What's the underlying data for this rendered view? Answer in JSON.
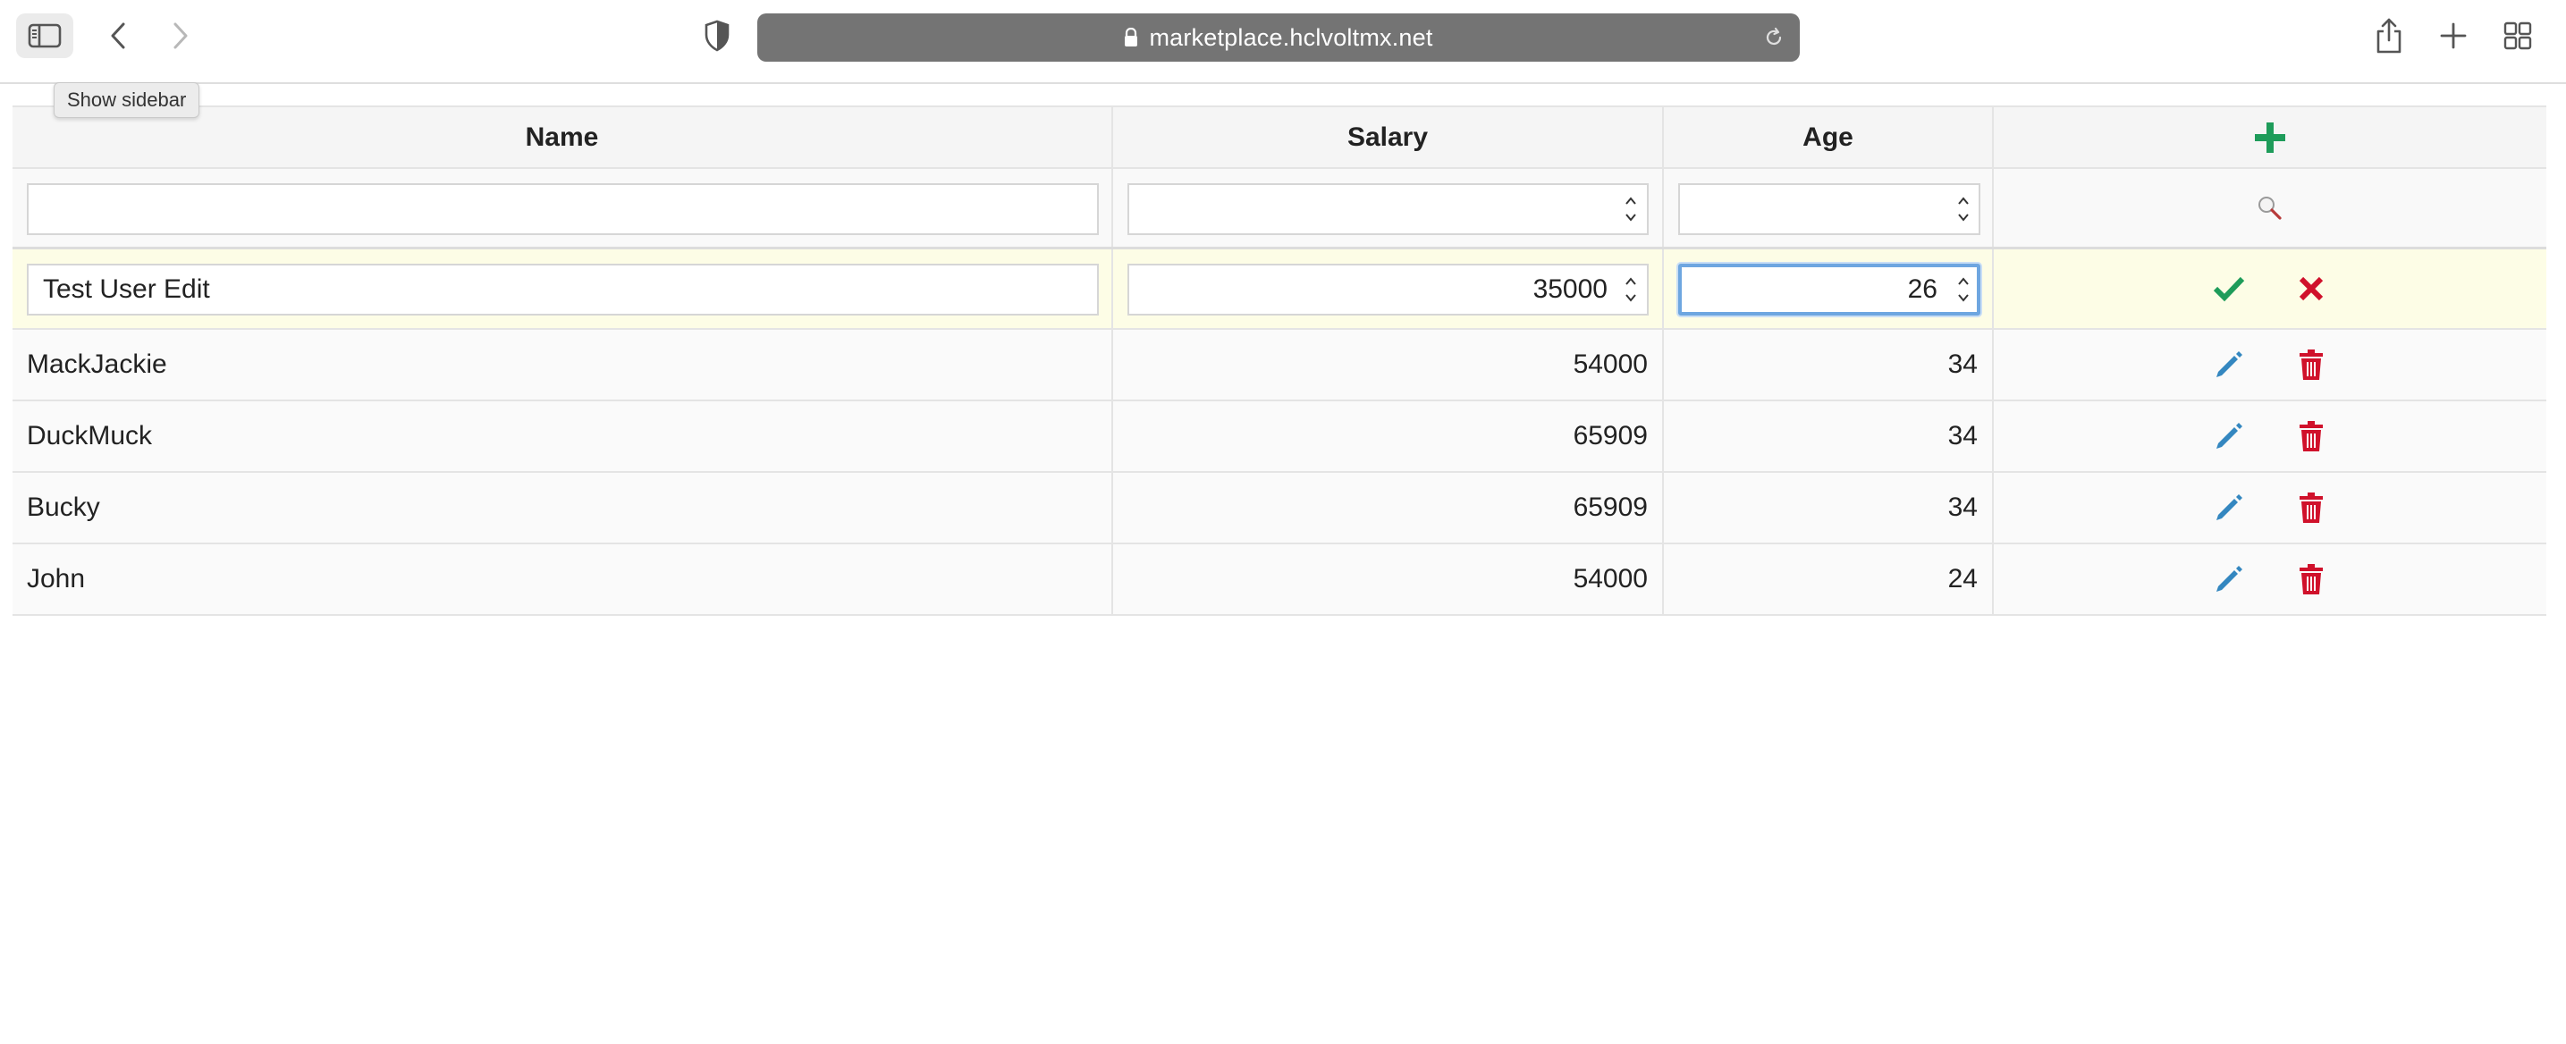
{
  "browser": {
    "url": "marketplace.hclvoltmx.net",
    "tooltip": "Show sidebar"
  },
  "grid": {
    "columns": [
      "Name",
      "Salary",
      "Age"
    ],
    "filter": {
      "name": "",
      "salary": "",
      "age": ""
    },
    "edit_row": {
      "name": "Test User Edit",
      "salary": "35000",
      "age": "26"
    },
    "rows": [
      {
        "name": "MackJackie",
        "salary": "54000",
        "age": "34"
      },
      {
        "name": "DuckMuck",
        "salary": "65909",
        "age": "34"
      },
      {
        "name": "Bucky",
        "salary": "65909",
        "age": "34"
      },
      {
        "name": "John",
        "salary": "54000",
        "age": "24"
      }
    ]
  },
  "colors": {
    "add": "#1e9c5a",
    "save": "#1e9c5a",
    "cancel": "#d0112b",
    "edit": "#3487c0",
    "delete": "#d0112b",
    "edit_row_bg": "#fdfde6",
    "focus_border": "#6ea6e0"
  },
  "icons": {
    "add": "plus-icon",
    "search": "search-icon",
    "save": "checkmark-icon",
    "cancel": "x-icon",
    "edit": "pencil-icon",
    "delete": "trash-icon"
  }
}
